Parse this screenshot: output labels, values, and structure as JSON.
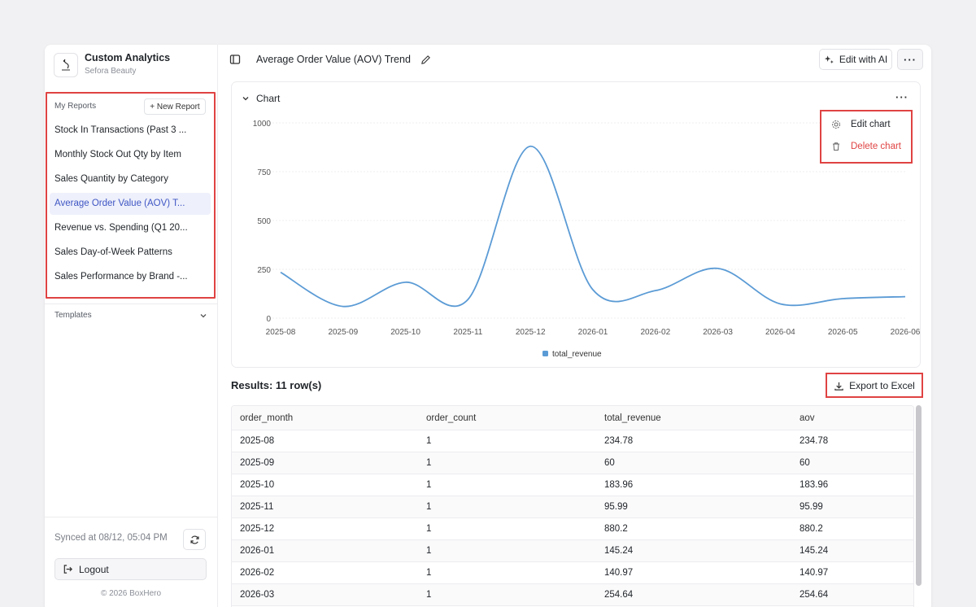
{
  "brand": {
    "title": "Custom Analytics",
    "subtitle": "Sefora Beauty",
    "logo_icon": "sefora-logo"
  },
  "sidebar": {
    "reports_heading": "My Reports",
    "new_report_label": "+ New Report",
    "reports": [
      {
        "label": "Stock In Transactions (Past 3 ...",
        "active": false
      },
      {
        "label": "Monthly Stock Out Qty by Item",
        "active": false
      },
      {
        "label": "Sales Quantity by Category",
        "active": false
      },
      {
        "label": "Average Order Value (AOV) T...",
        "active": true
      },
      {
        "label": "Revenue vs. Spending (Q1 20...",
        "active": false
      },
      {
        "label": "Sales Day-of-Week Patterns",
        "active": false
      },
      {
        "label": "Sales Performance by Brand -...",
        "active": false
      }
    ],
    "templates_label": "Templates",
    "synced_text": "Synced at 08/12, 05:04 PM",
    "logout_label": "Logout",
    "copyright": "© 2026 BoxHero"
  },
  "header": {
    "title": "Average Order Value (AOV) Trend",
    "edit_ai_label": "Edit with AI",
    "more_label": "···"
  },
  "chart_card": {
    "label": "Chart",
    "more_label": "···",
    "menu": {
      "edit_label": "Edit chart",
      "delete_label": "Delete chart"
    }
  },
  "chart_data": {
    "type": "line",
    "x": [
      "2025-08",
      "2025-09",
      "2025-10",
      "2025-11",
      "2025-12",
      "2026-01",
      "2026-02",
      "2026-03",
      "2026-04",
      "2026-05",
      "2026-06"
    ],
    "series": [
      {
        "name": "total_revenue",
        "values": [
          234.78,
          60,
          183.96,
          95.99,
          880.2,
          145.24,
          140.97,
          254.64,
          73,
          100,
          110
        ]
      }
    ],
    "yticks": [
      0,
      250,
      500,
      750,
      1000
    ],
    "ylim": [
      0,
      1000
    ],
    "grid": true,
    "legend": "bottom",
    "color": "#5b9bd5"
  },
  "results": {
    "title": "Results: 11 row(s)",
    "export_label": "Export to Excel",
    "columns": [
      "order_month",
      "order_count",
      "total_revenue",
      "aov"
    ],
    "rows": [
      [
        "2025-08",
        "1",
        "234.78",
        "234.78"
      ],
      [
        "2025-09",
        "1",
        "60",
        "60"
      ],
      [
        "2025-10",
        "1",
        "183.96",
        "183.96"
      ],
      [
        "2025-11",
        "1",
        "95.99",
        "95.99"
      ],
      [
        "2025-12",
        "1",
        "880.2",
        "880.2"
      ],
      [
        "2026-01",
        "1",
        "145.24",
        "145.24"
      ],
      [
        "2026-02",
        "1",
        "140.97",
        "140.97"
      ],
      [
        "2026-03",
        "1",
        "254.64",
        "254.64"
      ]
    ]
  },
  "colors": {
    "highlight": "#e04343",
    "active_text": "#3f56c4",
    "active_bg": "#eef0fb",
    "series": "#5b9bd5"
  }
}
